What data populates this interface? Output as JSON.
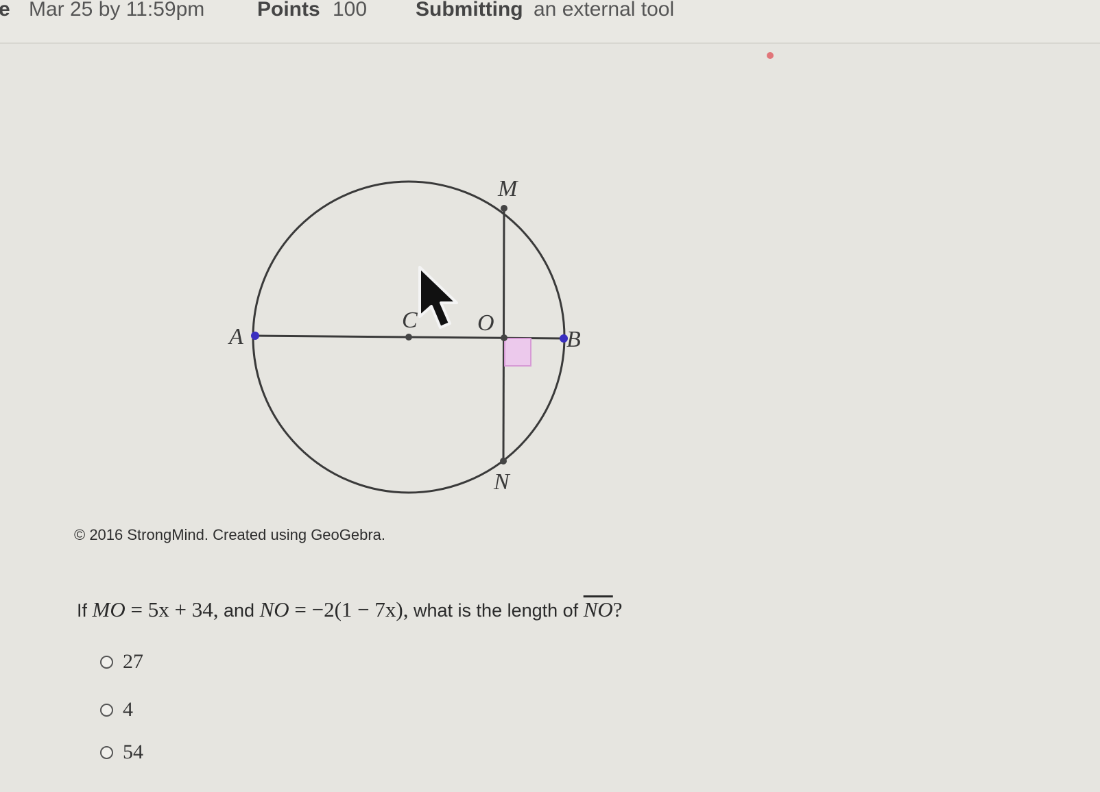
{
  "header": {
    "due_prefix": "e",
    "due_value": "Mar 25 by 11:59pm",
    "points_label": "Points",
    "points_value": "100",
    "submitting_label": "Submitting",
    "submitting_value": "an external tool"
  },
  "diagram": {
    "points": {
      "A": "A",
      "B": "B",
      "C": "C",
      "O": "O",
      "M": "M",
      "N": "N"
    },
    "colors": {
      "endpoint": "#3a2fc0",
      "right_angle": "#d79ad6",
      "line": "#3a3a3a"
    },
    "copyright": "© 2016 StrongMind. Created using GeoGebra."
  },
  "question": {
    "prefix": "If",
    "mo_lhs": "MO",
    "mo_rhs": "= 5x + 34,",
    "and": "and",
    "no_lhs": "NO",
    "no_rhs": "= −2(1 − 7x),",
    "suffix": "what is the length of",
    "segment": "NO",
    "end": "?"
  },
  "options": [
    {
      "label": "27"
    },
    {
      "label": "4"
    },
    {
      "label": "54"
    }
  ],
  "icons": {
    "cursor": "mouse-pointer-icon"
  }
}
